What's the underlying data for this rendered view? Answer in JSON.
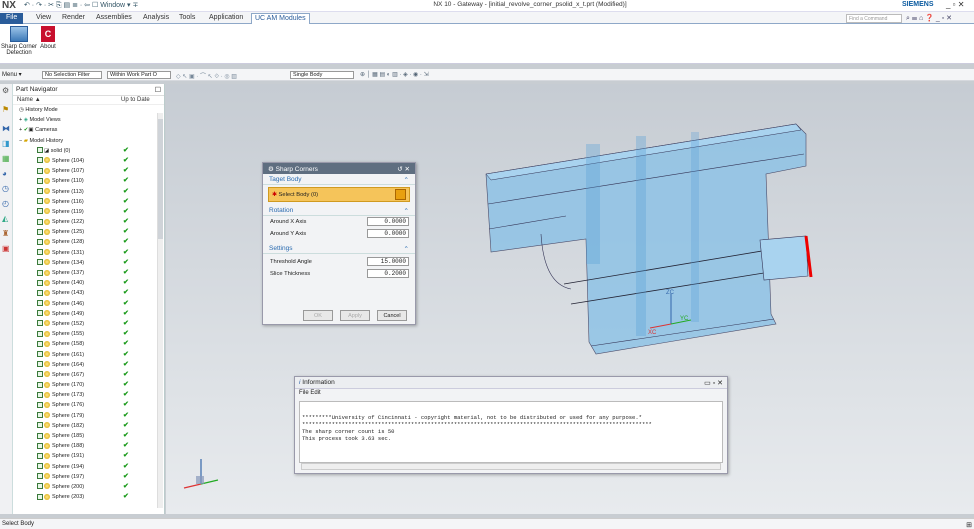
{
  "titlebar": {
    "logo": "NX",
    "quick_access": "↶ · ↷ · ✂ ⎘ ▤ ≣ · ⇦ ☐ Window ▾ ∓",
    "title": "NX 10 - Gateway - [initial_revolve_corner_psolid_x_t.prt (Modified)]",
    "brand": "SIEMENS",
    "window_controls": "_ ▫ ✕"
  },
  "menu": {
    "file": "File",
    "tabs": [
      "View",
      "Render",
      "Assemblies",
      "Analysis",
      "Tools",
      "Application",
      "UC AM Modules"
    ],
    "find_command": "Find a Command",
    "right_icons": "⌕ ☰ ⌂ ❓ _ ▫ ✕"
  },
  "ribbon": {
    "btn1": "Sharp Corner Detection",
    "btn2": "About"
  },
  "toolbar": {
    "menu": "Menu ▾",
    "filter": "No Selection Filter",
    "scope": "Within Work Part O",
    "body": "Single Body"
  },
  "navigator": {
    "title": "Part Navigator",
    "col_name": "Name",
    "col_uptodate": "Up to Date",
    "top_items": [
      "History Mode",
      "Model Views",
      "Cameras",
      "Model History"
    ],
    "solid": "solid (0)",
    "spheres": [
      "Sphere (104)",
      "Sphere (107)",
      "Sphere (110)",
      "Sphere (113)",
      "Sphere (116)",
      "Sphere (119)",
      "Sphere (122)",
      "Sphere (125)",
      "Sphere (128)",
      "Sphere (131)",
      "Sphere (134)",
      "Sphere (137)",
      "Sphere (140)",
      "Sphere (143)",
      "Sphere (146)",
      "Sphere (149)",
      "Sphere (152)",
      "Sphere (155)",
      "Sphere (158)",
      "Sphere (161)",
      "Sphere (164)",
      "Sphere (167)",
      "Sphere (170)",
      "Sphere (173)",
      "Sphere (176)",
      "Sphere (179)",
      "Sphere (182)",
      "Sphere (185)",
      "Sphere (188)",
      "Sphere (191)",
      "Sphere (194)",
      "Sphere (197)",
      "Sphere (200)",
      "Sphere (203)"
    ]
  },
  "dialog": {
    "title": "Sharp Corners",
    "sec1": "Taget Body",
    "select": "Select Body (0)",
    "sec2": "Rotation",
    "rx_label": "Around X Axis",
    "rx": "0.0000",
    "ry_label": "Around Y Axis",
    "ry": "0.0000",
    "sec3": "Settings",
    "ta_label": "Threshold Angle",
    "ta": "15.0000",
    "st_label": "Slice Thickness",
    "st": "0.2000",
    "ok": "OK",
    "apply": "Apply",
    "cancel": "Cancel"
  },
  "info": {
    "title": "Information",
    "menu_file": "File",
    "menu_edit": "Edit",
    "line1": "*********University of Cincinnati - copyright material, not to be distributed or used for any purpose.*",
    "line2": "**********************************************************************************************************",
    "line3": "The sharp corner count is 50",
    "line4": "This process took 3.63 sec."
  },
  "status": {
    "text": "Select Body"
  },
  "viewport": {
    "axis_zc": "ZC",
    "axis_yc": "YC",
    "axis_xc": "XC"
  }
}
